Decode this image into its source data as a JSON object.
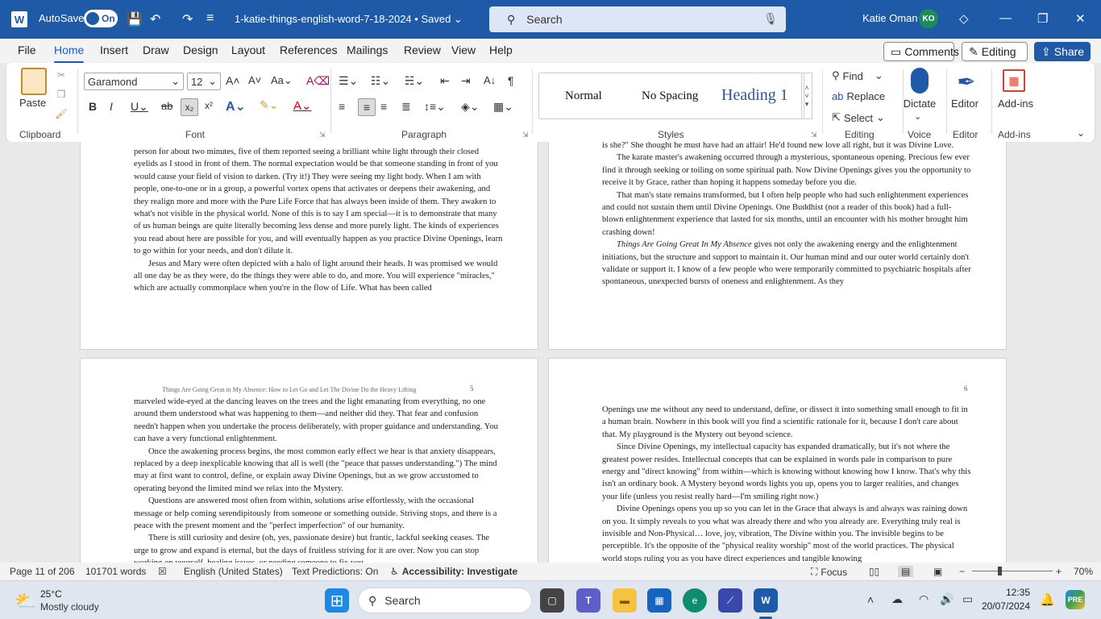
{
  "titlebar": {
    "app_logo": "W",
    "autosave_label": "AutoSave",
    "autosave_state": "On",
    "document_title": "1-katie-things-english-word-7-18-2024 • Saved ⌄",
    "search_placeholder": "Search",
    "user_name": "Katie Oman",
    "user_initials": "KO"
  },
  "menu": {
    "items": [
      "File",
      "Home",
      "Insert",
      "Draw",
      "Design",
      "Layout",
      "References",
      "Mailings",
      "Review",
      "View",
      "Help"
    ],
    "active": "Home",
    "comments_label": "Comments",
    "editing_label": "Editing",
    "share_label": "Share"
  },
  "ribbon": {
    "clipboard": {
      "paste_label": "Paste",
      "group_label": "Clipboard"
    },
    "font": {
      "font_name": "Garamond",
      "font_size": "12",
      "group_label": "Font"
    },
    "paragraph": {
      "group_label": "Paragraph"
    },
    "styles": {
      "items": [
        "Normal",
        "No Spacing",
        "Heading 1"
      ],
      "group_label": "Styles"
    },
    "editing": {
      "find_label": "Find",
      "replace_label": "Replace",
      "select_label": "Select",
      "group_label": "Editing"
    },
    "voice": {
      "dictate_label": "Dictate",
      "group_label": "Voice"
    },
    "editor": {
      "editor_label": "Editor",
      "group_label": "Editor"
    },
    "addins": {
      "label": "Add-ins",
      "group_label": "Add-ins"
    }
  },
  "pages": {
    "top_left": [
      "person for about two minutes, five of them reported seeing a brilliant white light through their closed eyelids as I stood in front of them. The normal expectation would be that someone standing in front of you would cause your field of vision to darken. (Try it!) They were seeing my light body. When I am with people, one-to-one or in a group, a powerful vortex opens that activates or deepens their awakening, and they realign more and more with the Pure Life Force that has always been inside of them. They awaken to what's not visible in the physical world. None of this is to say I am special—it is to demonstrate that many of us human beings are quite literally becoming less dense and more purely light. The kinds of experiences you read about here are possible for you, and will eventually happen as you practice Divine Openings, learn to go within for your needs, and don't dilute it.",
      "Jesus and Mary were often depicted with a halo of light around their heads. It was promised we would all one day be as they were, do the things they were able to do, and more. You will experience \"miracles,\" which are actually commonplace when you're in the flow of Life. What has been called"
    ],
    "top_right": [
      "is she?\" She thought he must have had an affair! He'd found new love all right, but it was Divine Love.",
      "The karate master's awakening occurred through a mysterious, spontaneous opening.  Precious few ever find it through seeking or toiling on some spiritual path. Now Divine Openings gives you the opportunity to receive it by Grace, rather than hoping it happens someday before you die.",
      "That man's state remains transformed, but I often help people who had such enlightenment experiences and could not sustain them until Divine Openings. One Buddhist (not a reader of this book) had a full-blown enlightenment experience that lasted for six months, until an encounter with his mother brought him crashing down!",
      "Things Are Going Great In My Absence gives not only the awakening energy and the enlightenment initiations, but the structure and support to maintain it. Our human mind and our outer world certainly don't validate or support it. I know of a few people who were temporarily committed to psychiatric hospitals after spontaneous, unexpected bursts of oneness and enlightenment. As they"
    ],
    "bottom_left_header": "Things Are Going Great in My Absence: How to Let Go and Let The Divine Do the Heavy Lifting",
    "bottom_left_number": "5",
    "bottom_left": [
      "marveled wide-eyed at the dancing leaves on the trees and the light emanating from everything, no one around them understood what was happening to them—and neither did they. That fear and confusion needn't happen when you undertake the process deliberately, with proper guidance and understanding. You can have a very functional enlightenment.",
      "Once the awakening process begins, the most common early effect we hear is that anxiety disappears, replaced by a deep inexplicable knowing that all is well (the \"peace that passes understanding.\") The mind may at first want to control, define, or explain away Divine Openings, but as we grow accustomed to operating beyond the limited mind we relax into the Mystery.",
      "Questions are answered most often from within, solutions arise effortlessly, with the occasional message or help coming serendipitously from someone or something outside. Striving stops, and there is a peace with the present moment and the \"perfect imperfection\" of our humanity.",
      "There is still curiosity and desire (oh, yes, passionate desire) but frantic, lackful seeking ceases. The urge to grow and expand is eternal, but the days of fruitless striving for it are over. Now you can stop working on yourself, healing issues, or needing someone to fix you."
    ],
    "bottom_right_number": "6",
    "bottom_right": [
      "Openings use me without any need to understand, define, or dissect it into something small enough to fit in a human brain. Nowhere in this book will you find a scientific rationale for it, because I don't care about that. My playground is the Mystery out beyond science.",
      "Since Divine Openings, my intellectual capacity has expanded dramatically, but it's not where the greatest power resides. Intellectual concepts that can be explained in words pale in comparison to pure energy and \"direct knowing\" from within—which is knowing without knowing how I know. That's why this isn't an ordinary book. A Mystery beyond words lights you up, opens you to larger realities, and changes your life (unless you resist really hard—I'm smiling right now.)",
      "Divine Openings opens you up so you can let in the Grace that always is and always was raining down on you. It simply reveals to you what was already there and who you already are. Everything truly real is invisible and Non-Physical… love, joy, vibration, The Divine within you. The invisible begins to be perceptible. It's the opposite of the \"physical reality worship\" most of the world practices. The physical world stops ruling you as you have direct experiences and tangible knowing"
    ]
  },
  "statusbar": {
    "page_info": "Page 11 of 206",
    "word_count": "101701 words",
    "language": "English (United States)",
    "predictions": "Text Predictions: On",
    "accessibility": "Accessibility: Investigate",
    "focus_label": "Focus",
    "zoom_level": "70%",
    "zoom_fraction": 0.34
  },
  "taskbar": {
    "weather_temp": "25°C",
    "weather_desc": "Mostly cloudy",
    "search_label": "Search",
    "time": "12:35",
    "date": "20/07/2024"
  },
  "colors": {
    "accent": "#1e5aa8",
    "titlebar": "#1e5aa8"
  }
}
